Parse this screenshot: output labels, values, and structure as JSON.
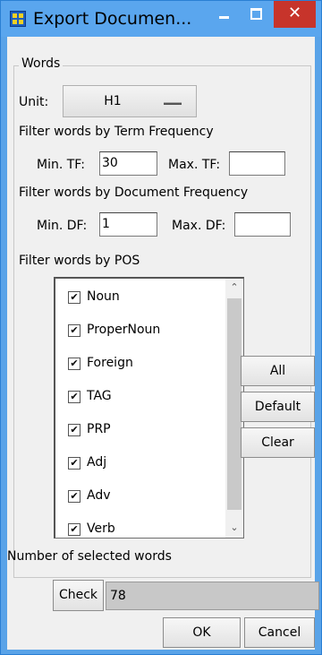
{
  "window": {
    "title": "Export Documen...",
    "close_glyph": "✕"
  },
  "words_group": {
    "title": "Words",
    "unit_label": "Unit:",
    "unit_value": "H1",
    "tf_heading": "Filter words by Term Frequency",
    "min_tf_label": "Min. TF:",
    "min_tf_value": "30",
    "max_tf_label": "Max. TF:",
    "max_tf_value": "",
    "df_heading": "Filter words by Document Frequency",
    "min_df_label": "Min. DF:",
    "min_df_value": "1",
    "max_df_label": "Max. DF:",
    "max_df_value": "",
    "pos_heading": "Filter words by POS",
    "pos_items": [
      {
        "label": "Noun",
        "checked": true
      },
      {
        "label": "ProperNoun",
        "checked": true
      },
      {
        "label": "Foreign",
        "checked": true
      },
      {
        "label": "TAG",
        "checked": true
      },
      {
        "label": "PRP",
        "checked": true
      },
      {
        "label": "Adj",
        "checked": true
      },
      {
        "label": "Adv",
        "checked": true
      },
      {
        "label": "Verb",
        "checked": true
      }
    ],
    "check_glyph": "✔",
    "scroll_up_glyph": "⌃",
    "scroll_down_glyph": "⌄",
    "all_button": "All",
    "default_button": "Default",
    "clear_button": "Clear"
  },
  "selected_words": {
    "label": "Number of selected words",
    "check_button": "Check",
    "count": "78"
  },
  "footer": {
    "ok_button": "OK",
    "cancel_button": "Cancel"
  }
}
